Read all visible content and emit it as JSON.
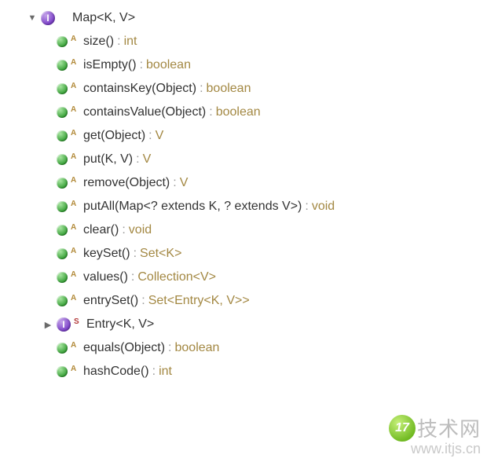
{
  "root": {
    "name": "Map<K, V>",
    "expanded": true
  },
  "methods": [
    {
      "mod": "A",
      "sig": "size()",
      "ret": "int"
    },
    {
      "mod": "A",
      "sig": "isEmpty()",
      "ret": "boolean"
    },
    {
      "mod": "A",
      "sig": "containsKey(Object)",
      "ret": "boolean"
    },
    {
      "mod": "A",
      "sig": "containsValue(Object)",
      "ret": "boolean"
    },
    {
      "mod": "A",
      "sig": "get(Object)",
      "ret": "V"
    },
    {
      "mod": "A",
      "sig": "put(K, V)",
      "ret": "V"
    },
    {
      "mod": "A",
      "sig": "remove(Object)",
      "ret": "V"
    },
    {
      "mod": "A",
      "sig": "putAll(Map<? extends K, ? extends V>)",
      "ret": "void"
    },
    {
      "mod": "A",
      "sig": "clear()",
      "ret": "void"
    },
    {
      "mod": "A",
      "sig": "keySet()",
      "ret": "Set<K>"
    },
    {
      "mod": "A",
      "sig": "values()",
      "ret": "Collection<V>"
    },
    {
      "mod": "A",
      "sig": "entrySet()",
      "ret": "Set<Entry<K, V>>"
    }
  ],
  "inner": {
    "mod": "S",
    "name": "Entry<K, V>",
    "expanded": false
  },
  "tail": [
    {
      "mod": "A",
      "sig": "equals(Object)",
      "ret": "boolean"
    },
    {
      "mod": "A",
      "sig": "hashCode()",
      "ret": "int"
    }
  ],
  "watermark": {
    "badge": "17",
    "zh": "技术网",
    "url": "www.itjs.cn"
  },
  "sep": ":"
}
